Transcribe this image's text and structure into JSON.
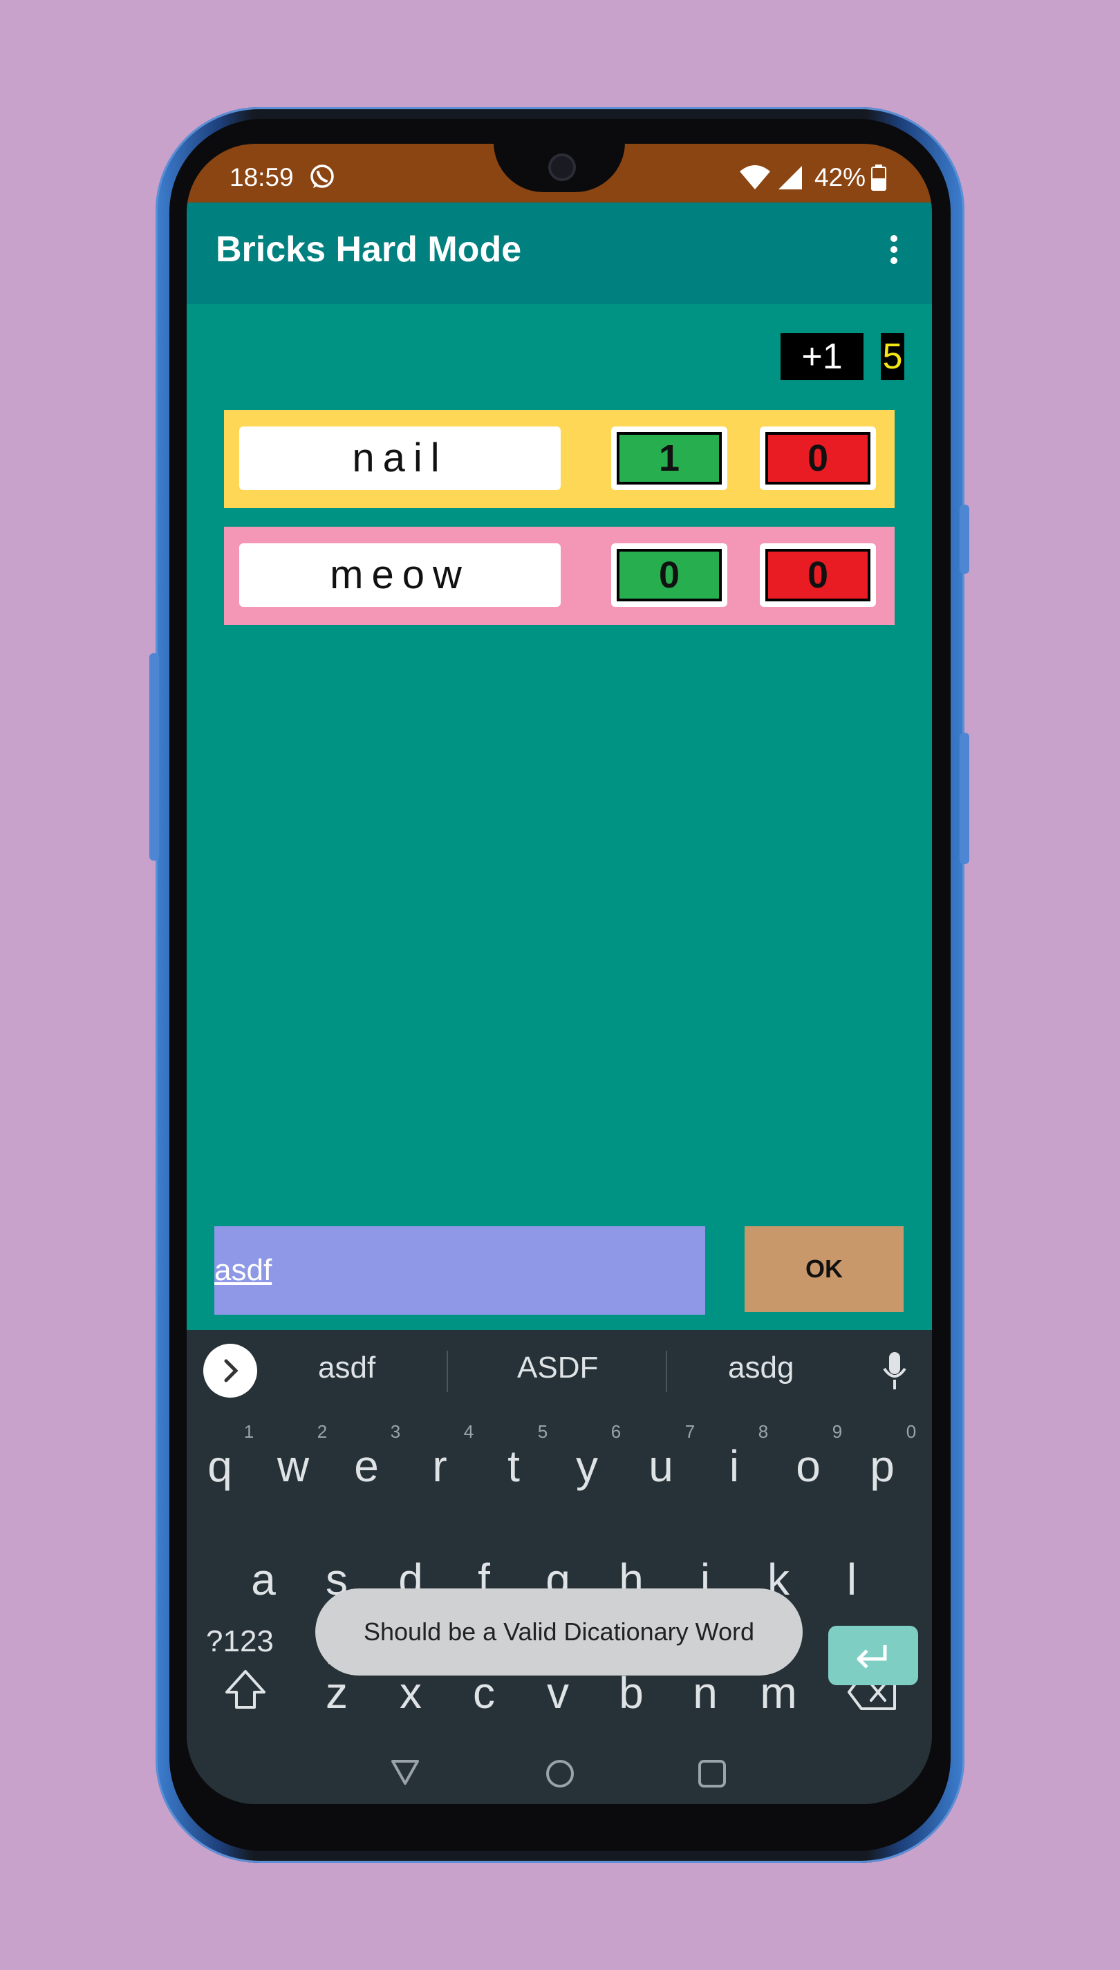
{
  "status_bar": {
    "time": "18:59",
    "battery": "42%"
  },
  "app_bar": {
    "title": "Bricks Hard Mode"
  },
  "score": {
    "bonus": "+1",
    "total": "5"
  },
  "word_rows": [
    {
      "word": "nail",
      "green": "1",
      "red": "0",
      "color": "#fdd755"
    },
    {
      "word": "meow",
      "green": "0",
      "red": "0",
      "color": "#f497b6"
    }
  ],
  "input": {
    "value": "asdf"
  },
  "ok_label": "OK",
  "suggestions": [
    "asdf",
    "ASDF",
    "asdg"
  ],
  "keyboard": {
    "row1": [
      "q",
      "w",
      "e",
      "r",
      "t",
      "y",
      "u",
      "i",
      "o",
      "p"
    ],
    "row1_hints": [
      "1",
      "2",
      "3",
      "4",
      "5",
      "6",
      "7",
      "8",
      "9",
      "0"
    ],
    "row2": [
      "a",
      "s",
      "d",
      "f",
      "g",
      "h",
      "j",
      "k",
      "l"
    ],
    "row3": [
      "z",
      "x",
      "c",
      "v",
      "b",
      "n",
      "m"
    ],
    "symbols_label": "?123"
  },
  "toast": "Should be a Valid Dicationary Word",
  "colors": {
    "status_bar": "#8b4513",
    "app_bar": "#00807f",
    "content": "#009384",
    "green_count": "#27ae4f",
    "red_count": "#e91c24",
    "input_bg": "#8e98e6",
    "ok_bg": "#c9986a",
    "total_score_text": "#f5e616"
  }
}
